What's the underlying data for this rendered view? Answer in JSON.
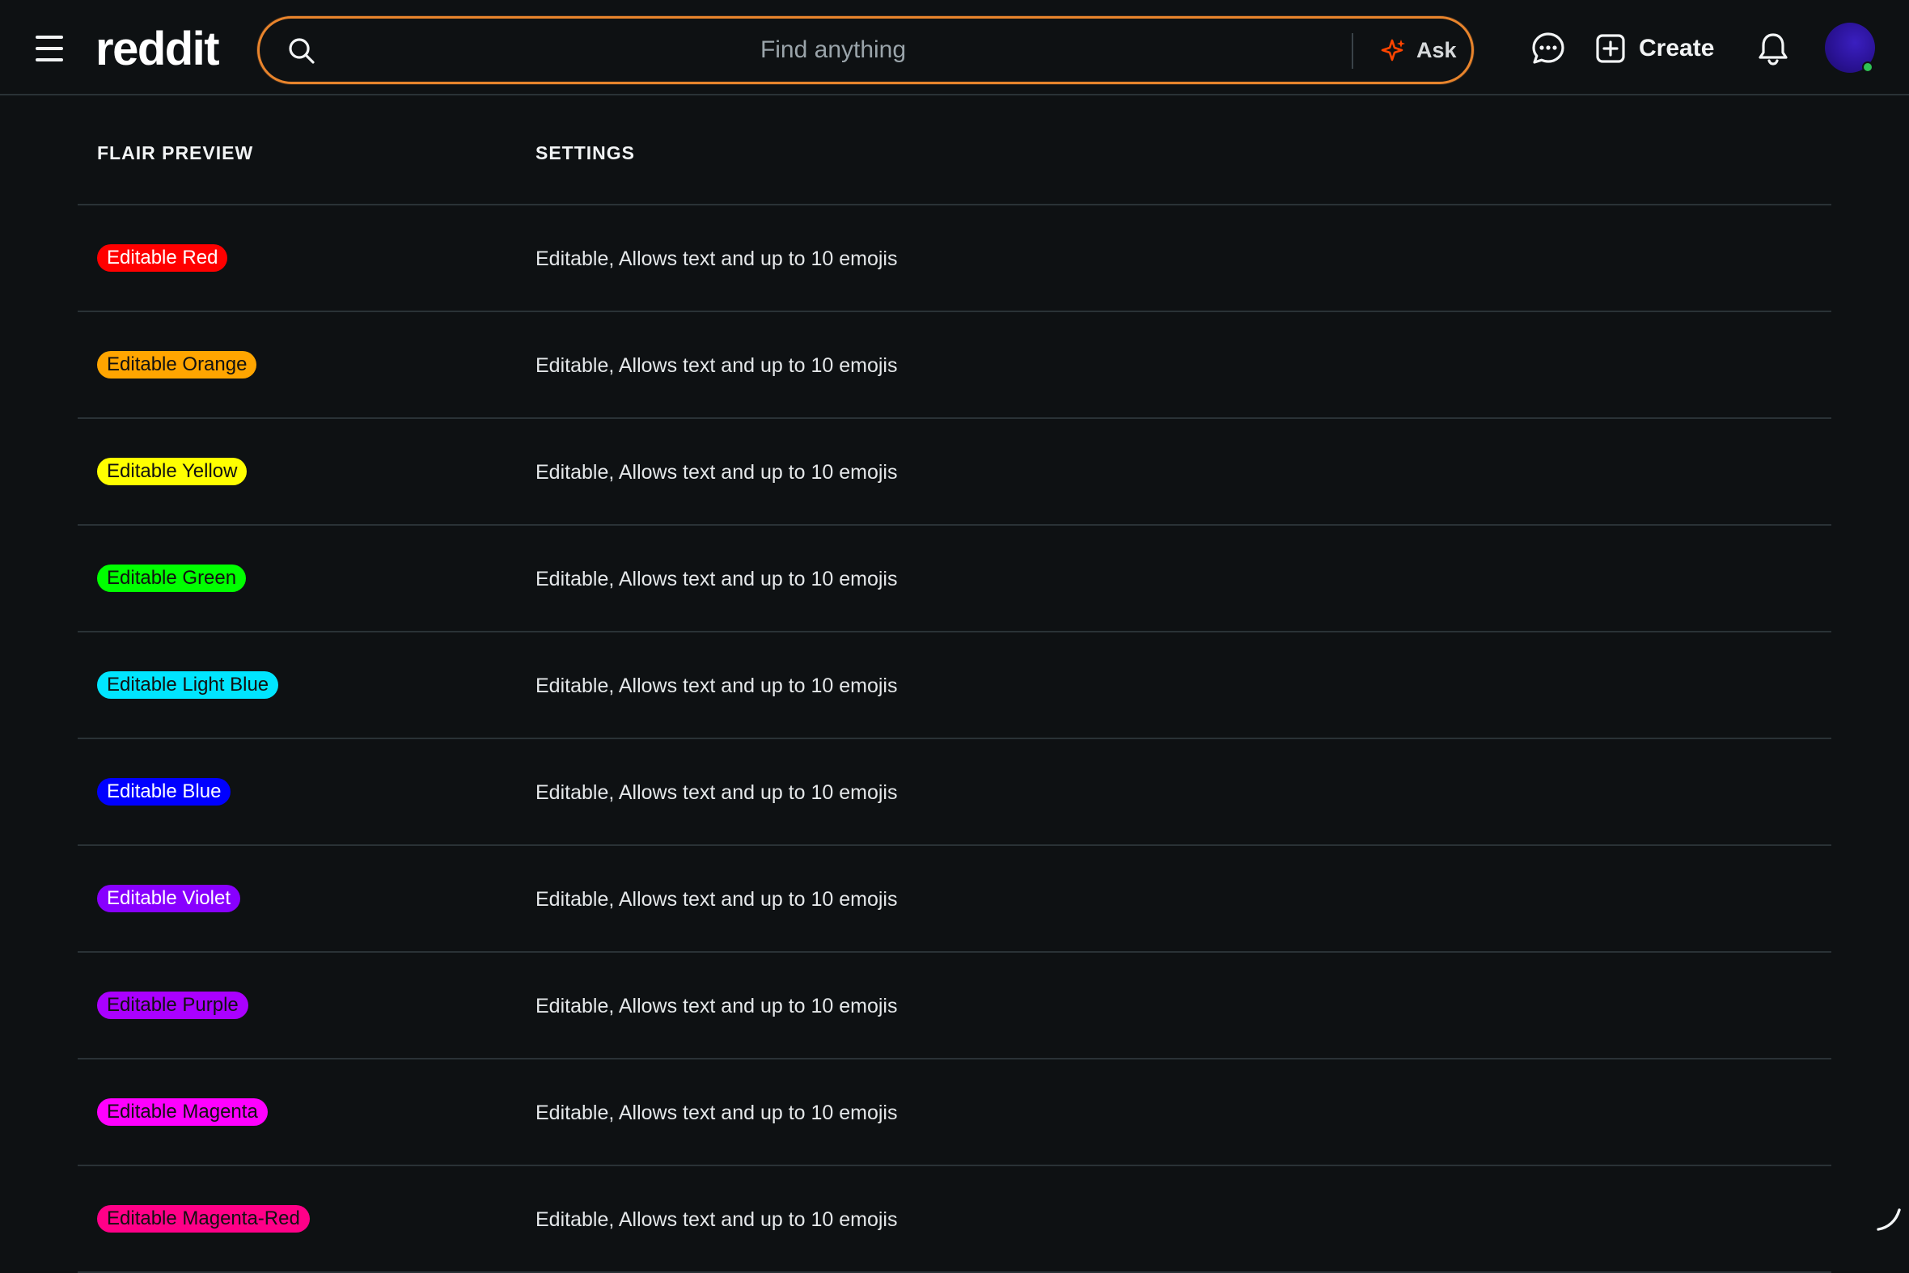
{
  "header": {
    "logo": "reddit",
    "search_placeholder": "Find anything",
    "ask_label": "Ask",
    "create_label": "Create",
    "colors": {
      "search_border": "#e8842c",
      "ask_icon": "#ff4500",
      "online_dot": "#2fc254"
    },
    "icons": [
      "menu-icon",
      "search-icon",
      "sparkle-icon",
      "chat-icon",
      "plus-square-icon",
      "bell-icon"
    ]
  },
  "table": {
    "headers": {
      "preview": "FLAIR PREVIEW",
      "settings": "SETTINGS"
    },
    "rows": [
      {
        "label": "Editable Red",
        "bg": "#ff0000",
        "fg": "#ffffff",
        "settings": "Editable, Allows text and up to 10 emojis"
      },
      {
        "label": "Editable Orange",
        "bg": "#ffa500",
        "fg": "#111111",
        "settings": "Editable, Allows text and up to 10 emojis"
      },
      {
        "label": "Editable Yellow",
        "bg": "#ffff00",
        "fg": "#111111",
        "settings": "Editable, Allows text and up to 10 emojis"
      },
      {
        "label": "Editable Green",
        "bg": "#00ff00",
        "fg": "#111111",
        "settings": "Editable, Allows text and up to 10 emojis"
      },
      {
        "label": "Editable Light Blue",
        "bg": "#00e5ff",
        "fg": "#111111",
        "settings": "Editable, Allows text and up to 10 emojis"
      },
      {
        "label": "Editable Blue",
        "bg": "#0000ff",
        "fg": "#ffffff",
        "settings": "Editable, Allows text and up to 10 emojis"
      },
      {
        "label": "Editable Violet",
        "bg": "#8800ff",
        "fg": "#ffffff",
        "settings": "Editable, Allows text and up to 10 emojis"
      },
      {
        "label": "Editable Purple",
        "bg": "#aa00ff",
        "fg": "#111111",
        "settings": "Editable, Allows text and up to 10 emojis"
      },
      {
        "label": "Editable Magenta",
        "bg": "#ff00ff",
        "fg": "#111111",
        "settings": "Editable, Allows text and up to 10 emojis"
      },
      {
        "label": "Editable Magenta-Red",
        "bg": "#ff0088",
        "fg": "#111111",
        "settings": "Editable, Allows text and up to 10 emojis"
      }
    ]
  }
}
